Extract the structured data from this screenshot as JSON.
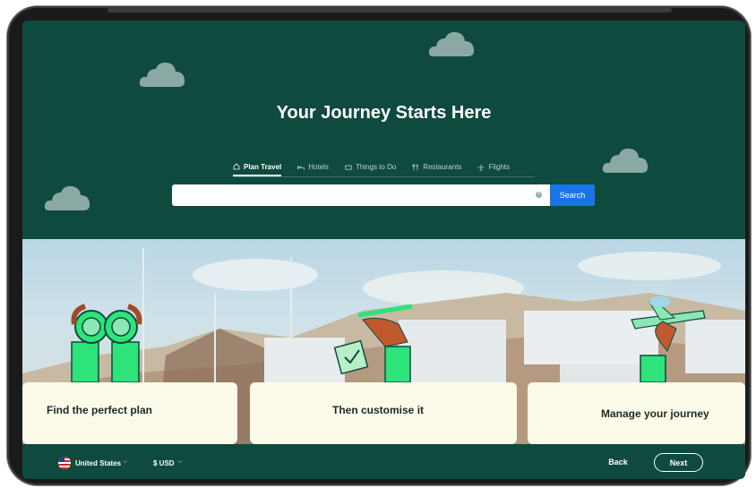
{
  "header": {
    "title": "Your Journey Starts Here",
    "tabs": [
      {
        "label": "Plan Travel",
        "icon": "house-icon",
        "active": true
      },
      {
        "label": "Hotels",
        "icon": "bed-icon",
        "active": false
      },
      {
        "label": "Things to Do",
        "icon": "ticket-icon",
        "active": false
      },
      {
        "label": "Restaurants",
        "icon": "fork-knife-icon",
        "active": false
      },
      {
        "label": "Flights",
        "icon": "plane-icon",
        "active": false
      }
    ]
  },
  "search": {
    "value": "",
    "placeholder": "",
    "button_label": "Search"
  },
  "cards": [
    {
      "label": "Find the perfect plan"
    },
    {
      "label": "Then customise it"
    },
    {
      "label": "Manage your journey"
    }
  ],
  "footer": {
    "country": "United States",
    "currency": "$ USD",
    "back_label": "Back",
    "next_label": "Next"
  },
  "colors": {
    "brand_dark_green": "#0f4a3e",
    "search_blue": "#1a73e8",
    "card_cream": "#fcfbe9",
    "illustration_green": "#2ee37a"
  }
}
